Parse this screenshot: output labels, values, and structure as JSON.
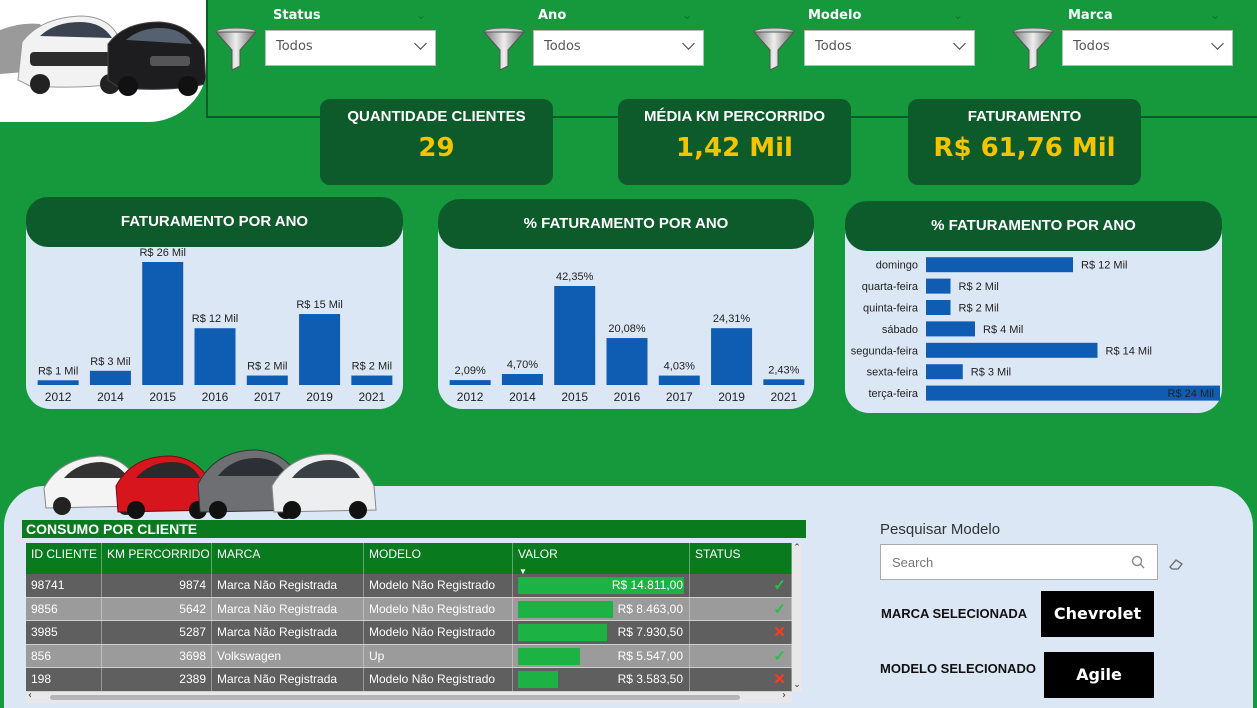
{
  "filters": [
    {
      "label": "Status",
      "value": "Todos"
    },
    {
      "label": "Ano",
      "value": "Todos"
    },
    {
      "label": "Modelo",
      "value": "Todos"
    },
    {
      "label": "Marca",
      "value": "Todos"
    }
  ],
  "kpis": [
    {
      "title": "QUANTIDADE CLIENTES",
      "value": "29"
    },
    {
      "title": "MÉDIA KM PERCORRIDO",
      "value": "1,42 Mil"
    },
    {
      "title": "FATURAMENTO",
      "value": "R$ 61,76 Mil"
    }
  ],
  "chart_data": [
    {
      "type": "bar",
      "title": "FATURAMENTO POR ANO",
      "categories": [
        "2012",
        "2014",
        "2015",
        "2016",
        "2017",
        "2019",
        "2021"
      ],
      "values": [
        1,
        3,
        26,
        12,
        2,
        15,
        2
      ],
      "labels": [
        "R$ 1 Mil",
        "R$ 3 Mil",
        "R$ 26 Mil",
        "R$ 12 Mil",
        "R$ 2 Mil",
        "R$ 15 Mil",
        "R$ 2 Mil"
      ],
      "color": "#0f5cb3"
    },
    {
      "type": "bar",
      "title": "% FATURAMENTO POR ANO",
      "categories": [
        "2012",
        "2014",
        "2015",
        "2016",
        "2017",
        "2019",
        "2021"
      ],
      "values": [
        2.09,
        4.7,
        42.35,
        20.08,
        4.03,
        24.31,
        2.43
      ],
      "labels": [
        "2,09%",
        "4,70%",
        "42,35%",
        "20,08%",
        "4,03%",
        "24,31%",
        "2,43%"
      ],
      "color": "#0f5cb3"
    },
    {
      "type": "bar",
      "orientation": "horizontal",
      "title": "% FATURAMENTO POR ANO",
      "categories": [
        "domingo",
        "quarta-feira",
        "quinta-feira",
        "sábado",
        "segunda-feira",
        "sexta-feira",
        "terça-feira"
      ],
      "values": [
        12,
        2,
        2,
        4,
        14,
        3,
        24
      ],
      "labels": [
        "R$ 12 Mil",
        "R$ 2 Mil",
        "R$ 2 Mil",
        "R$ 4 Mil",
        "R$ 14 Mil",
        "R$ 3 Mil",
        "R$ 24 Mil"
      ],
      "color": "#0f5cb3"
    }
  ],
  "table": {
    "title": "CONSUMO POR CLIENTE",
    "headers": [
      "ID CLIENTE",
      "KM PERCORRIDO",
      "MARCA",
      "MODELO",
      "VALOR",
      "STATUS"
    ],
    "rows": [
      {
        "id": "98741",
        "km": "9874",
        "marca": "Marca Não Registrada",
        "modelo": "Modelo Não Registrado",
        "valor": "R$ 14.811,00",
        "amount": 14811,
        "status": "ok"
      },
      {
        "id": "9856",
        "km": "5642",
        "marca": "Marca Não Registrada",
        "modelo": "Modelo Não Registrado",
        "valor": "R$ 8.463,00",
        "amount": 8463,
        "status": "ok"
      },
      {
        "id": "3985",
        "km": "5287",
        "marca": "Marca Não Registrada",
        "modelo": "Modelo Não Registrado",
        "valor": "R$ 7.930,50",
        "amount": 7930.5,
        "status": "fail"
      },
      {
        "id": "856",
        "km": "3698",
        "marca": "Volkswagen",
        "modelo": "Up",
        "valor": "R$ 5.547,00",
        "amount": 5547,
        "status": "ok"
      },
      {
        "id": "198",
        "km": "2389",
        "marca": "Marca Não Registrada",
        "modelo": "Modelo Não Registrado",
        "valor": "R$ 3.583,50",
        "amount": 3583.5,
        "status": "fail"
      }
    ]
  },
  "search": {
    "title": "Pesquisar Modelo",
    "placeholder": "Search"
  },
  "selected": {
    "marca_label": "MARCA SELECIONADA",
    "marca_value": "Chevrolet",
    "modelo_label": "MODELO SELECIONADO",
    "modelo_value": "Agile"
  },
  "colors": {
    "background": "#15993c",
    "dark_green": "#0d5a2b",
    "gold": "#f2c500",
    "bar_blue": "#0f5cb3",
    "panel": "#dbe7f5",
    "table_green": "#0a7a1e",
    "value_bar": "#1db344"
  }
}
